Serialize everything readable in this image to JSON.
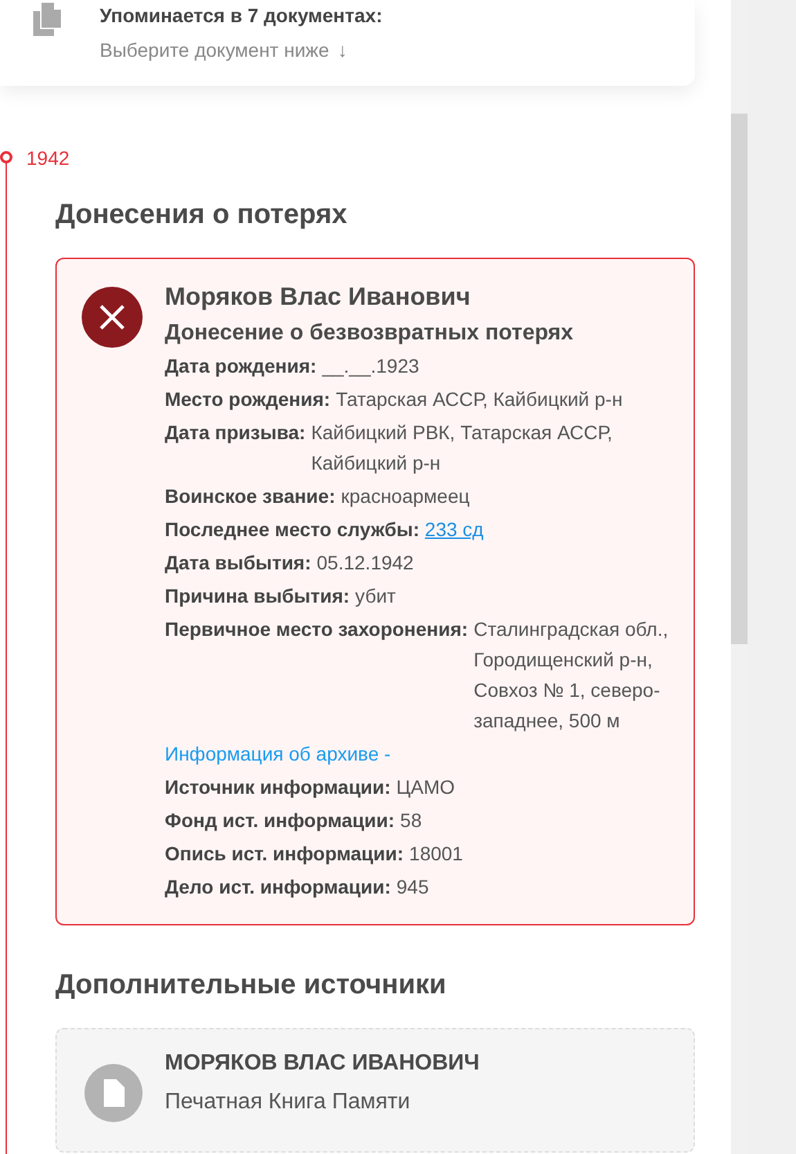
{
  "mentions": {
    "title": "Упоминается в 7 документах:",
    "hint": "Выберите документ ниже",
    "arrow": "↓"
  },
  "timeline": {
    "year": "1942"
  },
  "losses_section": {
    "heading": "Донесения о потерях",
    "card": {
      "name": "Моряков Влас Иванович",
      "subtitle": "Донесение о безвозвратных потерях",
      "rows": [
        {
          "kind": "field",
          "label": "Дата рождения:",
          "value": "__.__.1923"
        },
        {
          "kind": "field",
          "label": "Место рождения:",
          "value": "Татарская АССР, Кайбицкий р-н"
        },
        {
          "kind": "field",
          "label": "Дата призыва:",
          "value": "Кайбицкий РВК, Татарская АССР, Кайбицкий р-н"
        },
        {
          "kind": "field",
          "label": "Воинское звание:",
          "value": "красноармеец"
        },
        {
          "kind": "link",
          "label": "Последнее место службы:",
          "value": "233 сд"
        },
        {
          "kind": "field",
          "label": "Дата выбытия:",
          "value": "05.12.1942"
        },
        {
          "kind": "field",
          "label": "Причина выбытия:",
          "value": "убит"
        },
        {
          "kind": "field",
          "label": "Первичное место захоронения:",
          "value": "Сталинградская обл., Городищенский р-н, Совхоз № 1, северо-западнее, 500 м"
        },
        {
          "kind": "section",
          "value": "Информация об архиве -"
        },
        {
          "kind": "field",
          "label": "Источник информации:",
          "value": "ЦАМО"
        },
        {
          "kind": "field",
          "label": "Фонд ист. информации:",
          "value": "58"
        },
        {
          "kind": "field",
          "label": "Опись ист. информации:",
          "value": "18001"
        },
        {
          "kind": "field",
          "label": "Дело ист. информации:",
          "value": "945"
        }
      ]
    }
  },
  "extra_section": {
    "heading": "Дополнительные источники",
    "card": {
      "name": "МОРЯКОВ ВЛАС ИВАНОВИЧ",
      "subtitle": "Печатная Книга Памяти"
    }
  }
}
